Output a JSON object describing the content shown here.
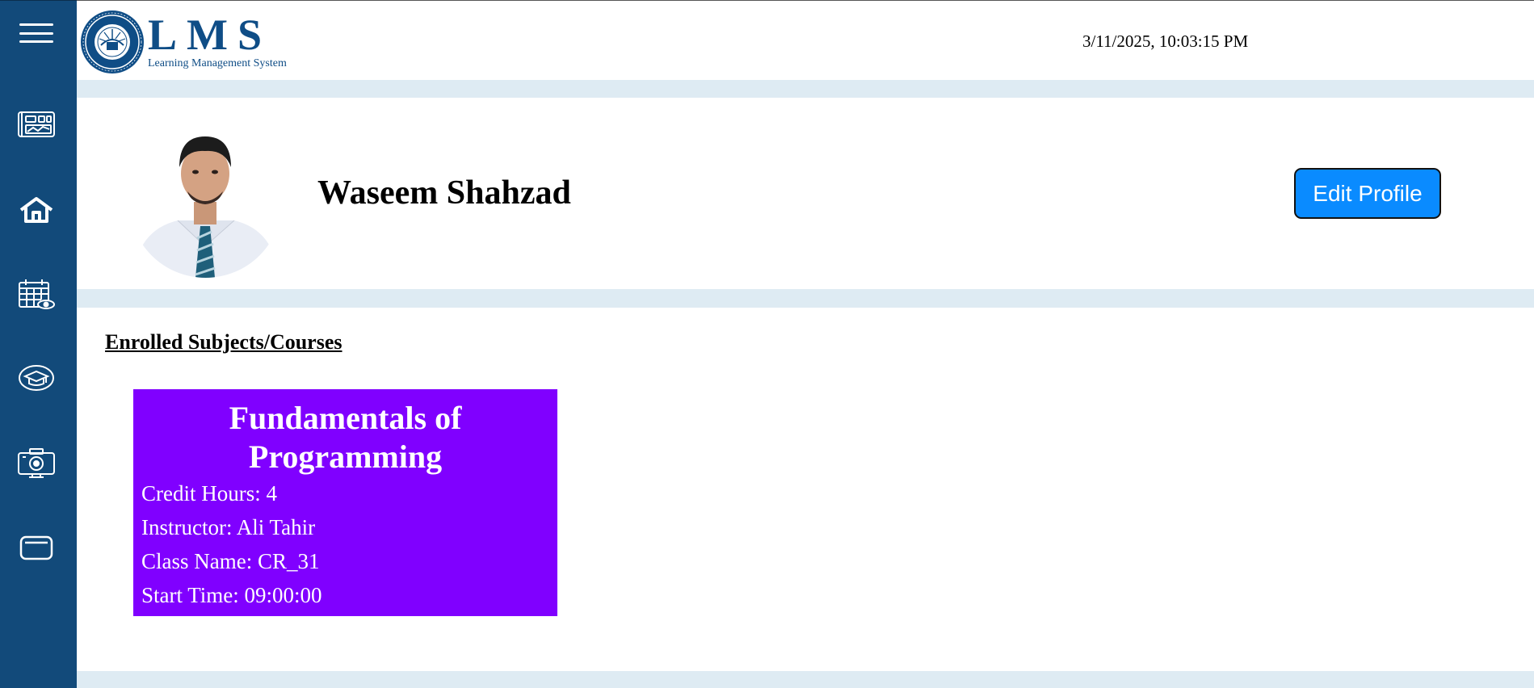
{
  "app": {
    "logo_title": "LMS",
    "logo_subtitle": "Learning Management System",
    "datetime": "3/11/2025, 10:03:15 PM"
  },
  "sidebar": {
    "items": [
      {
        "icon": "dashboard-icon"
      },
      {
        "icon": "home-icon"
      },
      {
        "icon": "calendar-view-icon"
      },
      {
        "icon": "graduation-cap-icon"
      },
      {
        "icon": "camera-icon"
      },
      {
        "icon": "folder-icon"
      }
    ]
  },
  "profile": {
    "name": "Waseem Shahzad",
    "edit_label": "Edit Profile"
  },
  "courses": {
    "section_title": "Enrolled Subjects/Courses",
    "items": [
      {
        "title": "Fundamentals of Programming",
        "credit_hours": "Credit Hours: 4",
        "instructor": "Instructor: Ali Tahir",
        "class_name": "Class Name: CR_31",
        "start_time": "Start Time: 09:00:00"
      }
    ]
  },
  "colors": {
    "sidebar": "#124a7a",
    "accent_button": "#0a8bff",
    "course_card": "#8000ff",
    "band": "#deebf3",
    "logo": "#0f4d86"
  }
}
